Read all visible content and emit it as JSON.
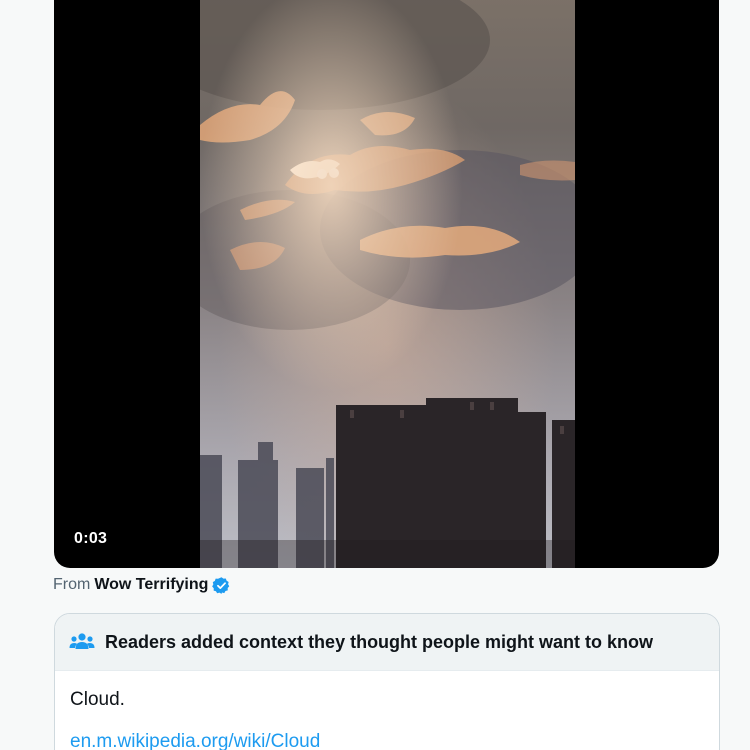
{
  "video": {
    "timestamp": "0:03"
  },
  "attribution": {
    "prefix": "From",
    "source_name": "Wow Terrifying",
    "verified": true
  },
  "community_note": {
    "header": "Readers added context they thought people might want to know",
    "text": "Cloud.",
    "link_text": "en.m.wikipedia.org/wiki/Cloud"
  },
  "colors": {
    "accent": "#1d9bf0",
    "text_primary": "#0f1419",
    "text_secondary": "#536471",
    "border": "#cfd9de",
    "header_bg": "#eff3f4"
  },
  "icons": {
    "verified": "verified-badge-icon",
    "notes": "people-icon"
  }
}
